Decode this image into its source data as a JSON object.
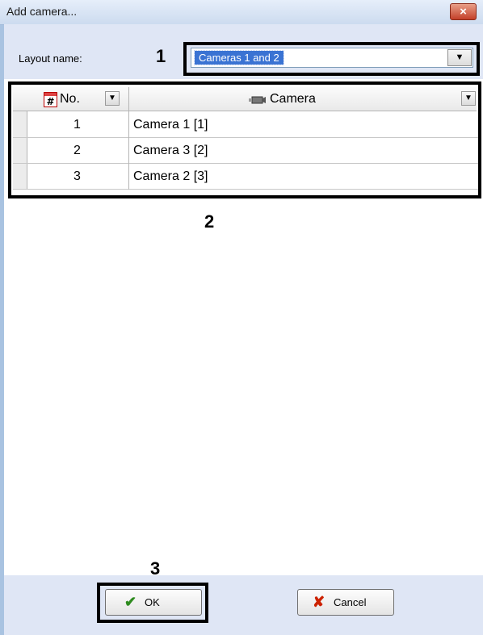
{
  "window": {
    "title": "Add camera...",
    "close_glyph": "×"
  },
  "layout": {
    "label": "Layout name:",
    "selected": "Cameras 1 and 2",
    "dropdown_icon": "chevron-down-icon"
  },
  "table": {
    "columns": [
      {
        "label": "No.",
        "icon": "hash-icon"
      },
      {
        "label": "Camera",
        "icon": "camera-icon"
      }
    ],
    "rows": [
      {
        "no": "1",
        "camera": "Camera 1 [1]"
      },
      {
        "no": "2",
        "camera": "Camera 3 [2]"
      },
      {
        "no": "3",
        "camera": "Camera 2 [3]"
      }
    ]
  },
  "callouts": [
    "1",
    "2",
    "3"
  ],
  "buttons": {
    "ok": {
      "label": "OK",
      "icon": "checkmark-icon",
      "color": "#2e8b1f"
    },
    "cancel": {
      "label": "Cancel",
      "icon": "red-x-icon",
      "color": "#cc2200"
    }
  },
  "colors": {
    "panel_bg": "#dfe6f5",
    "selection": "#3a73d3",
    "highlight_border": "#000000"
  }
}
